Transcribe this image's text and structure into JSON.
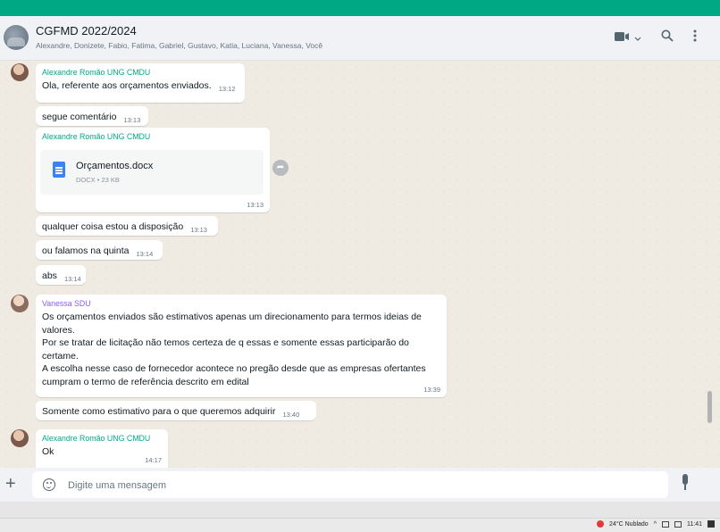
{
  "header": {
    "title": "CGFMD 2022/2024",
    "members": "Alexandre, Donizete, Fabio, Fatima, Gabriel, Gustavo, Katia, Luciana, Vanessa, Você",
    "video_icon": "video-call-icon",
    "video_dropdown_icon": "chevron-down-icon",
    "search_icon": "search-icon",
    "menu_icon": "menu-icon"
  },
  "messages": [
    {
      "sender": "Alexandre Romão UNG CMDU",
      "text": "Ola, referente aos orçamentos enviados.",
      "time": "13:12"
    },
    {
      "text": "segue comentário",
      "time": "13:13"
    },
    {
      "sender": "Alexandre Romão UNG CMDU",
      "file_name": "Orçamentos.docx",
      "file_meta": "DOCX • 23 KB",
      "time": "13:13"
    },
    {
      "text": "qualquer coisa estou a disposição",
      "time": "13:13"
    },
    {
      "text": "ou falamos na quinta",
      "time": "13:14"
    },
    {
      "text": "abs",
      "time": "13:14"
    },
    {
      "sender": "Vanessa SDU",
      "lines": [
        "Os orçamentos enviados são estimativos apenas um direcionamento para termos ideias de",
        "valores.",
        "Por se tratar de licitação não temos certeza de q essas e somente essas participarão do",
        "certame.",
        "A escolha nesse caso de fornecedor acontece no pregão desde que as empresas ofertantes",
        "cumpram o termo de referência descrito em edital"
      ],
      "time": "13:39"
    },
    {
      "text": "Somente como estimativo para o que queremos adquirir",
      "time": "13:40"
    },
    {
      "sender": "Alexandre Romão UNG CMDU",
      "text": "Ok",
      "time": "14:17"
    }
  ],
  "composer": {
    "placeholder": "Digite uma mensagem",
    "plus_icon": "plus-icon",
    "emoji_icon": "emoji-icon",
    "mic_icon": "mic-icon"
  },
  "taskbar": {
    "weather": "24°C  Nublado",
    "time": "11:41"
  },
  "colors": {
    "accent": "#00a884",
    "sender_alexandre": "#06a884",
    "sender_vanessa": "#8b5cf6",
    "chat_bg": "#efeae2"
  }
}
